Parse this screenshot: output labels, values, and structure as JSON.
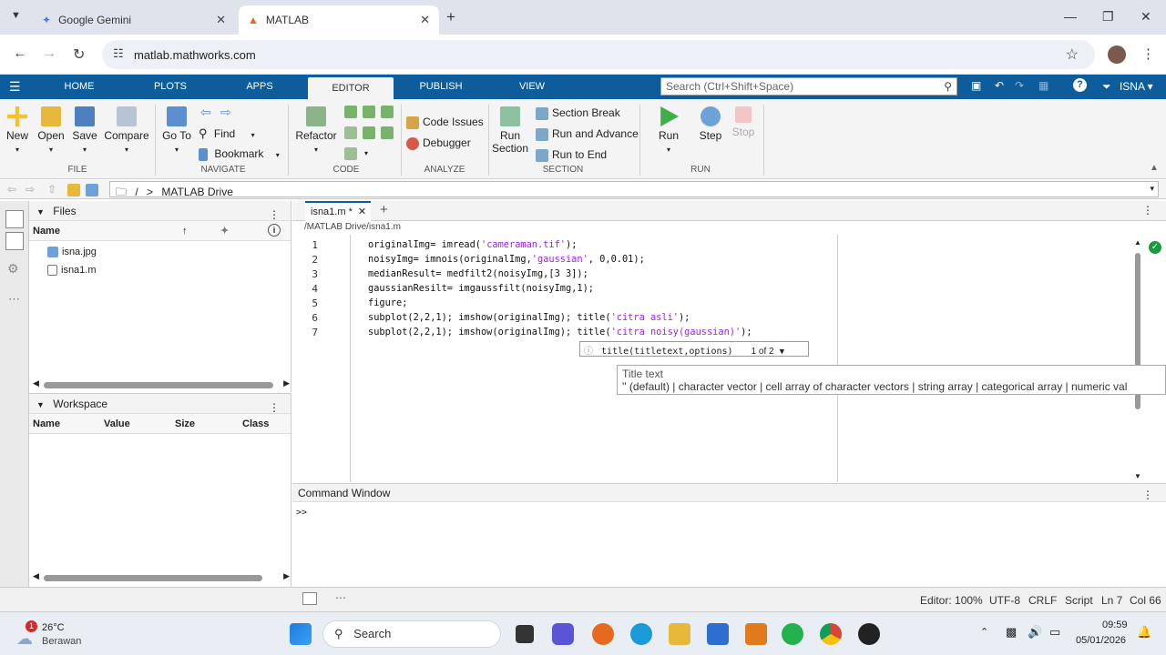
{
  "browser": {
    "tabs": [
      {
        "title": "Google Gemini"
      },
      {
        "title": "MATLAB"
      }
    ],
    "url": "matlab.mathworks.com"
  },
  "matlab": {
    "tabs": [
      "HOME",
      "PLOTS",
      "APPS",
      "EDITOR",
      "PUBLISH",
      "VIEW"
    ],
    "search_placeholder": "Search (Ctrl+Shift+Space)",
    "user": "ISNA"
  },
  "ribbon": {
    "file": {
      "new": "New",
      "open": "Open",
      "save": "Save",
      "compare": "Compare",
      "label": "FILE"
    },
    "navigate": {
      "goto": "Go To",
      "find": "Find",
      "bookmark": "Bookmark",
      "label": "NAVIGATE"
    },
    "code": {
      "refactor": "Refactor",
      "label": "CODE"
    },
    "analyze": {
      "code_issues": "Code Issues",
      "debugger": "Debugger",
      "label": "ANALYZE"
    },
    "section": {
      "run_section_1": "Run",
      "run_section_2": "Section",
      "section_break": "Section Break",
      "run_advance": "Run and Advance",
      "run_end": "Run to End",
      "label": "SECTION"
    },
    "run": {
      "run": "Run",
      "step": "Step",
      "stop": "Stop",
      "label": "RUN"
    }
  },
  "path": {
    "sep": "/",
    "arrow": ">",
    "folder": "MATLAB Drive"
  },
  "files": {
    "title": "Files",
    "col_name": "Name",
    "items": [
      "isna.jpg",
      "isna1.m"
    ]
  },
  "workspace": {
    "title": "Workspace",
    "cols": [
      "Name",
      "Value",
      "Size",
      "Class"
    ]
  },
  "editor": {
    "tab": "isna1.m *",
    "path": "/MATLAB Drive/isna1.m",
    "lines": [
      {
        "n": "1",
        "a": "originalImg= imread(",
        "s": "'cameraman.tif'",
        "b": ");"
      },
      {
        "n": "2",
        "a": "noisyImg= imnois(originalImg,",
        "s": "'gaussian'",
        "b": ", 0,0.01);"
      },
      {
        "n": "3",
        "a": "medianResult= medfilt2(noisyImg,[3 3]);",
        "s": "",
        "b": ""
      },
      {
        "n": "4",
        "a": "gaussianResilt= imgaussfilt(noisyImg,1);",
        "s": "",
        "b": ""
      },
      {
        "n": "5",
        "a": "figure;",
        "s": "",
        "b": ""
      },
      {
        "n": "6",
        "a": "subplot(2,2,1); imshow(originalImg); title(",
        "s": "'citra asli'",
        "b": ");"
      },
      {
        "n": "7",
        "a": "subplot(2,2,1); imshow(originalImg); title(",
        "s": "'citra noisy(gaussian)'",
        "b": ");"
      }
    ],
    "hint_sig": "title(titletext,options)",
    "hint_count": "1 of 2",
    "hint_title": "Title text",
    "hint_types": "'' (default) | character vector | cell array of character vectors | string array | categorical array | numeric val"
  },
  "command_window": {
    "title": "Command Window",
    "prompt": ">>"
  },
  "status": {
    "zoom": "Editor: 100%",
    "encoding": "UTF-8",
    "eol": "CRLF",
    "type": "Script",
    "ln": "Ln 7",
    "col": "Col 66"
  },
  "taskbar": {
    "weather_temp": "26°C",
    "weather_desc": "Berawan",
    "notif_badge": "1",
    "search": "Search",
    "time": "09:59",
    "date": "05/01/2026"
  },
  "colors": {
    "matlab_blue": "#0d5c9c",
    "string": "#a020f0",
    "ok_green": "#1a9a3c"
  }
}
